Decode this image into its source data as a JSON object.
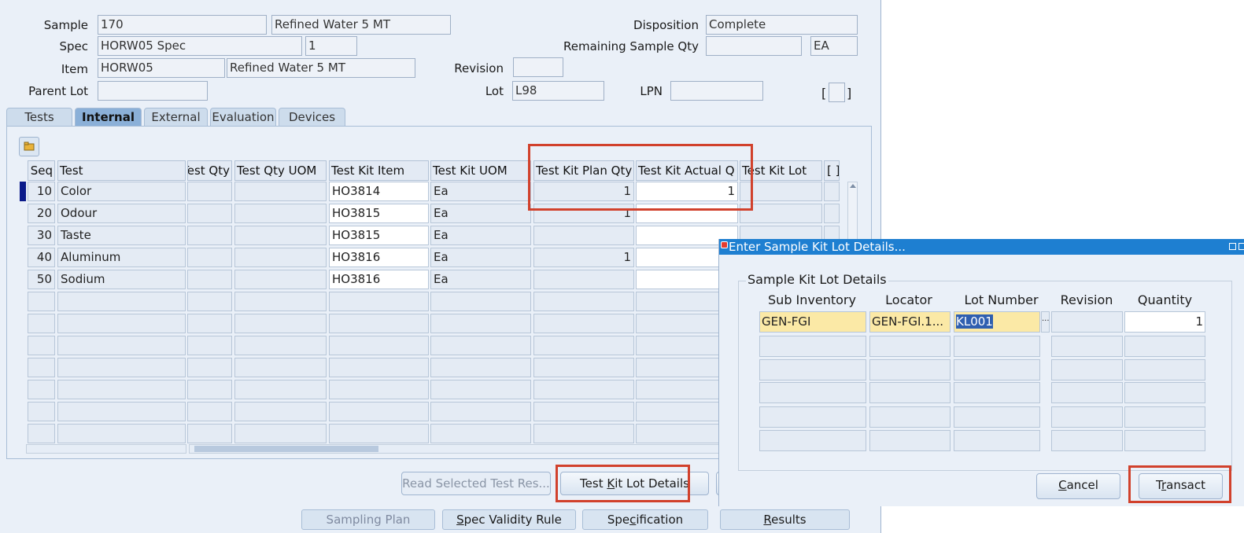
{
  "header": {
    "sample_label": "Sample",
    "sample_number": "170",
    "sample_desc": "Refined Water 5 MT",
    "spec_label": "Spec",
    "spec_value": "HORW05 Spec",
    "spec_version": "1",
    "item_label": "Item",
    "item_value": "HORW05",
    "item_desc": "Refined Water 5 MT",
    "parent_lot_label": "Parent Lot",
    "parent_lot_value": "",
    "revision_label": "Revision",
    "revision_value": "",
    "lot_label": "Lot",
    "lot_value": "L98",
    "lpn_label": "LPN",
    "lpn_value": "",
    "disposition_label": "Disposition",
    "disposition_value": "Complete",
    "remaining_label": "Remaining Sample Qty",
    "remaining_value": "",
    "remaining_uom": "EA",
    "bracket_open": "[",
    "bracket_close": "]"
  },
  "tabs": [
    {
      "label": "Tests",
      "active": false
    },
    {
      "label": "Internal",
      "active": true
    },
    {
      "label": "External",
      "active": false
    },
    {
      "label": "Evaluation",
      "active": false
    },
    {
      "label": "Devices",
      "active": false
    }
  ],
  "grid": {
    "columns": [
      "Seq",
      "Test",
      "Test Qty",
      "Test Qty UOM",
      "Test Kit Item",
      "Test Kit UOM",
      "Test Kit Plan Qty",
      "Test Kit Actual Q",
      "Test Kit Lot",
      "[ ]"
    ],
    "rows": [
      {
        "seq": "10",
        "test": "Color",
        "test_qty": "",
        "test_qty_uom": "",
        "kit_item": "HO3814",
        "kit_uom": "Ea",
        "plan_qty": "1",
        "actual_qty": "1",
        "kit_lot": ""
      },
      {
        "seq": "20",
        "test": "Odour",
        "test_qty": "",
        "test_qty_uom": "",
        "kit_item": "HO3815",
        "kit_uom": "Ea",
        "plan_qty": "1",
        "actual_qty": "",
        "kit_lot": ""
      },
      {
        "seq": "30",
        "test": "Taste",
        "test_qty": "",
        "test_qty_uom": "",
        "kit_item": "HO3815",
        "kit_uom": "Ea",
        "plan_qty": "",
        "actual_qty": "",
        "kit_lot": ""
      },
      {
        "seq": "40",
        "test": "Aluminum",
        "test_qty": "",
        "test_qty_uom": "",
        "kit_item": "HO3816",
        "kit_uom": "Ea",
        "plan_qty": "1",
        "actual_qty": "",
        "kit_lot": ""
      },
      {
        "seq": "50",
        "test": "Sodium",
        "test_qty": "",
        "test_qty_uom": "",
        "kit_item": "HO3816",
        "kit_uom": "Ea",
        "plan_qty": "",
        "actual_qty": "",
        "kit_lot": ""
      }
    ]
  },
  "buttons": {
    "read_selected": "Read Selected Test Res...",
    "test_kit_lot_details": "Test Kit Lot Details"
  },
  "bottom_tabs": [
    "Sampling Plan",
    "Spec Validity Rule",
    "Specification",
    "Results"
  ],
  "dialog": {
    "title": "Enter Sample Kit Lot Details...",
    "section_title": "Sample Kit Lot Details",
    "columns": [
      "Sub Inventory",
      "Locator",
      "Lot Number",
      "Revision",
      "Quantity"
    ],
    "rows": [
      {
        "sub_inventory": "GEN-FGI",
        "locator": "GEN-FGI.1...",
        "lot_number": "KL001",
        "lov": "...",
        "revision": "",
        "quantity": "1"
      }
    ],
    "cancel_label": "Cancel",
    "transact_label": "Transact"
  },
  "colors": {
    "highlight_border": "#d1412c",
    "dialog_title_bar": "#1e7fd1",
    "required_field": "#fbe9a6",
    "active_tab": "#8bb0d8"
  },
  "icons": [
    "folder-icon",
    "row-indicator",
    "dialog-close-icon",
    "dialog-minimize-icon",
    "dialog-maximize-icon"
  ]
}
